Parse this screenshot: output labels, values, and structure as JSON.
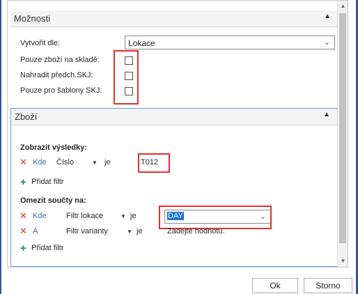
{
  "options_section": {
    "title": "Možnosti",
    "create_by_label": "Vytvořit dle:",
    "create_by_value": "Lokace",
    "only_stock_label": "Pouze zboží na skladě:",
    "replace_label": "Nahradit předch.SKJ:",
    "templates_label": "Pouze pro šablony SKJ:"
  },
  "items_section": {
    "title": "Zboží",
    "show_results_label": "Zobrazit výsledky:",
    "filter1": {
      "conj": "Kde",
      "field": "Číslo",
      "op": "je",
      "value": "T012"
    },
    "add_filter_1": "Přidat filtr",
    "limit_totals_label": "Omezit součty na:",
    "filter2": {
      "conj": "Kde",
      "field": "Filtr lokace",
      "op": "je",
      "value": "DAY"
    },
    "filter3": {
      "conj": "A",
      "field": "Filtr varianty",
      "op": "je",
      "value": "Zadejte hodnotu."
    },
    "add_filter_2": "Přidat filtr"
  },
  "footer": {
    "ok_label": "Ok",
    "cancel_label": "Storno"
  },
  "icons": {
    "collapse": "chevron-up-icon",
    "dropdown": "chevron-down-icon",
    "remove": "x-icon",
    "add": "plus-icon"
  },
  "colors": {
    "highlight": "#e0302c",
    "link": "#2e6fc4",
    "remove": "#d23b2c",
    "add": "#2e8b3c"
  }
}
